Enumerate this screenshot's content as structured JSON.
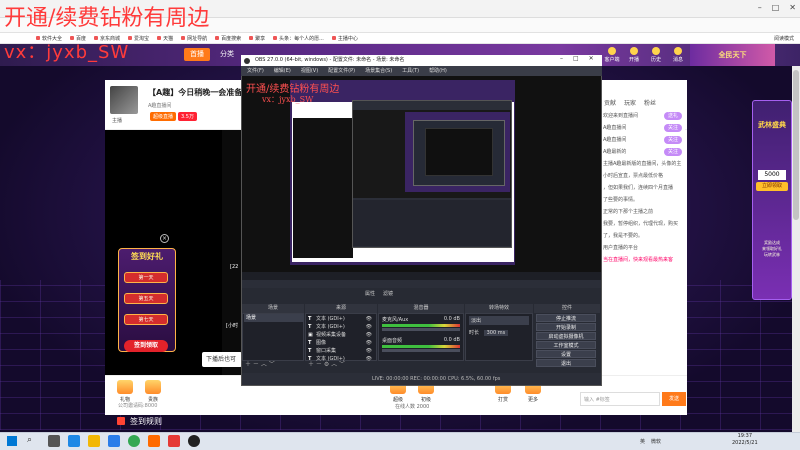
{
  "watermark": {
    "line1": "开通/续费钻粉有周边",
    "line2": "vx：jyxb_SW",
    "inner_line1": "开通/续费钻粉有周边",
    "inner_line2": "vx：jyxb_SW"
  },
  "bookmarks": [
    "软件大全",
    "百度",
    "京东商城",
    "爱淘宝",
    "天猫",
    "网址导航",
    "百度搜索",
    "聚享",
    "头条：每个人的愿...",
    "主播中心"
  ],
  "browser": {
    "read_mode": "阅读模式"
  },
  "header": {
    "nav_home": "首播",
    "nav_category": "分类",
    "icons": [
      "客户端",
      "开播",
      "历史",
      "消息"
    ],
    "banner": "全民天下"
  },
  "room": {
    "title": "【A趣】今日稍晚一会准备",
    "subtitle": "A趣直播间",
    "tag1": "超级直播",
    "tag2": "3.5万",
    "anchor": "主播",
    "gift_panel": {
      "title": "签到好礼",
      "btn1": "第一天",
      "btn2": "第五天",
      "btn3": "第七天",
      "claim": "签到领取"
    },
    "tooltip": "下播后也可",
    "overlay_num": "[22",
    "overlay_num2": "[小时",
    "notice": "公司邀请码:8000",
    "stat": "在线人数 2000",
    "gifts": [
      "礼物",
      "贵族",
      "超级",
      "初级",
      "打赏",
      "更多"
    ]
  },
  "chat": {
    "tabs": [
      "贡献",
      "玩家",
      "粉丝"
    ],
    "lines": [
      {
        "text": "欢迎来到直播间",
        "pill": "送礼"
      },
      {
        "text": "A趣直播间",
        "pill": "关注"
      },
      {
        "text": "A趣直播间",
        "pill": "关注"
      },
      {
        "text": "A趣最新的",
        "pill": "关注"
      },
      {
        "text": "主播A趣最新版的直播间，头像的主",
        "pill": ""
      },
      {
        "text": "小时后宣直，票点最低价格",
        "pill": ""
      },
      {
        "text": "，但如果我们，连续四个月直播",
        "pill": ""
      },
      {
        "text": "了些要的事情。",
        "pill": ""
      },
      {
        "text": "正常的下那个主播之前",
        "pill": ""
      },
      {
        "text": "我要，暂停组织，代理代现，购买",
        "pill": ""
      },
      {
        "text": "了，我是不要的。",
        "pill": ""
      },
      {
        "text": "用户直播的平台",
        "pill": ""
      },
      {
        "text": "当在直播间，快来观看最热来客",
        "pill": ""
      }
    ],
    "input_placeholder": "输入 #标签",
    "send": "发送"
  },
  "ad": {
    "title": "武林盛典",
    "number": "5000",
    "button": "立即领取",
    "lines": "奖励达成\n来领取好礼\n玩转武林"
  },
  "signin": "签到规则",
  "obs": {
    "title": "OBS 27.0.0 (64-bit, windows) - 配置文件: 未命名 - 场景: 未命名",
    "menu": [
      "文件(F)",
      "编辑(E)",
      "视图(V)",
      "配置文件(P)",
      "场景集合(S)",
      "工具(T)",
      "帮助(H)"
    ],
    "docks": {
      "scenes": "场景",
      "sources": "来源",
      "mixer": "混音器",
      "transitions": "转场特效",
      "controls": "控件"
    },
    "scene_items": [
      "场景"
    ],
    "sources_list": [
      "文本 (GDI+)",
      "文本 (GDI+)",
      "视频采集设备",
      "图像",
      "窗口采集",
      "文本 (GDI+)"
    ],
    "sources_toolbar": [
      "属性",
      "滤镜"
    ],
    "mixer": {
      "ch1": "桌面音频",
      "ch1_db": "0.0 dB",
      "ch2": "麦克风/Aux",
      "ch2_db": "0.0 dB"
    },
    "transition": {
      "label": "淡出",
      "duration_label": "时长",
      "duration": "300 ms"
    },
    "controls": [
      "停止推流",
      "开始录制",
      "启动虚拟摄像机",
      "工作室模式",
      "设置",
      "退出"
    ],
    "status": "LIVE: 00:00:00   REC: 00:00:00   CPU: 6.5%, 60.00 fps",
    "status_right": "检查 ⚠ 丢帧 0 (0.0%)"
  },
  "taskbar": {
    "time": "19:37",
    "date": "2022/5/21",
    "tray_items": [
      "英",
      "微软"
    ]
  }
}
